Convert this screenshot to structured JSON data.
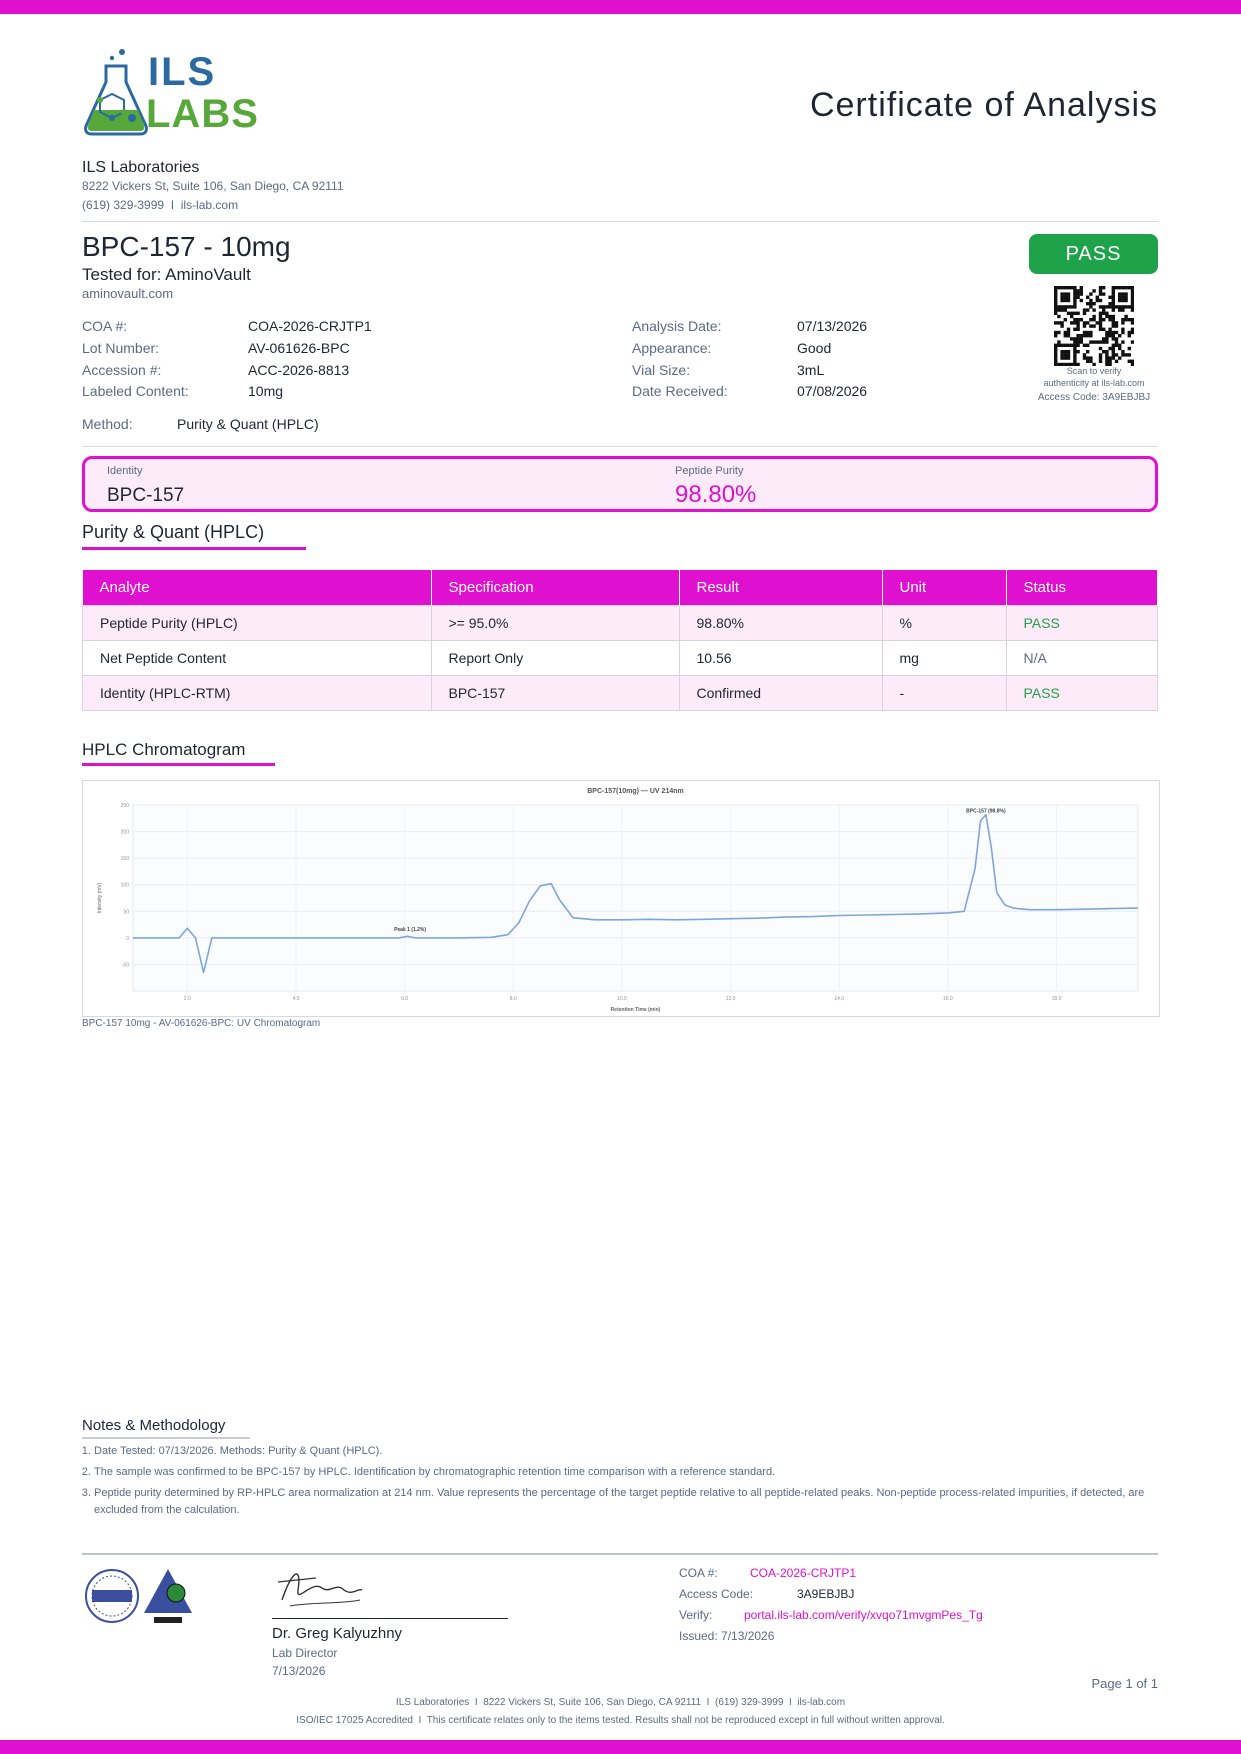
{
  "header": {
    "logo": {
      "line1": "ILS",
      "line2": "LABS",
      "icon": "flask-icon"
    },
    "title": "Certificate of Analysis",
    "lab_name": "ILS Laboratories",
    "address": "8222 Vickers St, Suite 106, San Diego, CA 92111",
    "contact": "(619) 329-3999  I  ils-lab.com"
  },
  "product": {
    "name": "BPC-157 - 10mg",
    "tested_for": "Tested for: AminoVault",
    "client_site": "aminovault.com",
    "status_badge": "PASS"
  },
  "meta_left": [
    {
      "label": "COA #:",
      "value": "COA-2026-CRJTP1"
    },
    {
      "label": "Lot Number:",
      "value": "AV-061626-BPC"
    },
    {
      "label": "Accession #:",
      "value": "ACC-2026-8813"
    },
    {
      "label": "Labeled Content:",
      "value": "10mg"
    }
  ],
  "meta_right": [
    {
      "label": "Analysis Date:",
      "value": "07/13/2026"
    },
    {
      "label": "Appearance:",
      "value": "Good"
    },
    {
      "label": "Vial Size:",
      "value": "3mL"
    },
    {
      "label": "Date Received:",
      "value": "07/08/2026"
    }
  ],
  "method": {
    "label": "Method:",
    "value": "Purity & Quant (HPLC)"
  },
  "qr": {
    "icon": "qr-code-icon",
    "caption1": "Scan to verify",
    "caption2": "authenticity at ils-lab.com",
    "access_code": "Access Code: 3A9EBJBJ"
  },
  "summary": {
    "identity_label": "Identity",
    "identity_value": "BPC-157",
    "purity_label": "Peptide Purity",
    "purity_value": "98.80%"
  },
  "results": {
    "title": "Purity & Quant (HPLC)",
    "columns": [
      "Analyte",
      "Specification",
      "Result",
      "Unit",
      "Status"
    ],
    "rows": [
      [
        "Peptide Purity (HPLC)",
        ">= 95.0%",
        "98.80%",
        "%",
        "PASS"
      ],
      [
        "Net Peptide Content",
        "Report Only",
        "10.56",
        "mg",
        "N/A"
      ],
      [
        "Identity (HPLC-RTM)",
        "BPC-157",
        "Confirmed",
        "-",
        "PASS"
      ]
    ]
  },
  "chromatogram": {
    "section_title": "HPLC Chromatogram",
    "caption": "BPC-157 10mg - AV-061626-BPC: UV Chromatogram",
    "chart_data": {
      "type": "line",
      "title": "BPC-157(10mg) — UV 214nm",
      "xlabel": "Retention Time (min)",
      "ylabel": "Intensity (mV)",
      "xlim": [
        1.0,
        19.5
      ],
      "ylim": [
        -100,
        250
      ],
      "grid": true,
      "yticks": [
        -50,
        0,
        50,
        100,
        150,
        200,
        250
      ],
      "xticks": [
        2,
        4,
        6,
        8,
        10,
        12,
        14,
        16,
        18
      ],
      "annotations": [
        {
          "text": "Peak 1 (1.2%)",
          "x": 6.1,
          "y": 2
        },
        {
          "text": "BPC-157 (98.8%)",
          "x": 16.7,
          "y": 225
        }
      ],
      "series": [
        {
          "color": "#7ea6de",
          "x": [
            1.0,
            1.7,
            1.85,
            2.0,
            2.15,
            2.3,
            2.45,
            2.6,
            3.0,
            4.0,
            5.0,
            5.9,
            6.05,
            6.2,
            6.5,
            7.0,
            7.6,
            7.9,
            8.1,
            8.3,
            8.5,
            8.7,
            8.85,
            9.1,
            9.5,
            10.0,
            10.5,
            11.0,
            11.5,
            12.0,
            12.5,
            13.0,
            13.5,
            14.0,
            14.5,
            15.0,
            15.5,
            16.0,
            16.3,
            16.5,
            16.6,
            16.7,
            16.8,
            16.9,
            17.05,
            17.2,
            17.5,
            18.0,
            18.5,
            19.0,
            19.5
          ],
          "y": [
            0,
            0,
            0,
            18,
            0,
            -65,
            0,
            0,
            0,
            0,
            0,
            0,
            3,
            0,
            0,
            0,
            1,
            6,
            28,
            70,
            98,
            102,
            72,
            38,
            34,
            34,
            35,
            34,
            35,
            36,
            37,
            39,
            40,
            42,
            43,
            44,
            45,
            47,
            50,
            130,
            220,
            232,
            170,
            85,
            62,
            56,
            53,
            53,
            54,
            55,
            56
          ]
        }
      ]
    }
  },
  "notes": {
    "title": "Notes & Methodology",
    "items": [
      "Date Tested: 07/13/2026. Methods: Purity & Quant (HPLC).",
      "The sample was confirmed to be BPC-157 by HPLC. Identification by chromatographic retention time comparison with a reference standard.",
      "Peptide purity determined by RP-HPLC area normalization at 214 nm. Value represents the percentage of the target peptide relative to all peptide-related peaks. Non-peptide process-related impurities, if detected, are excluded from the calculation."
    ]
  },
  "signature": {
    "seal1": "ilac-MRA",
    "seal2": "PJLA",
    "name": "Dr. Greg Kalyuzhny",
    "role": "Lab Director",
    "date": "7/13/2026"
  },
  "verify": {
    "coa_label": "COA #:",
    "coa_value": "COA-2026-CRJTP1",
    "access_label": "Access Code:",
    "access_value": "3A9EBJBJ",
    "verify_label": "Verify:",
    "verify_url": "portal.ils-lab.com/verify/xvqo71mvgmPes_Tg",
    "issued": "Issued: 7/13/2026"
  },
  "footer": {
    "page": "Page 1 of 1",
    "line1": "ILS Laboratories  I  8222 Vickers St, Suite 106, San Diego, CA 92111  I  (619) 329-3999  I  ils-lab.com",
    "line2": "ISO/IEC 17025 Accredited  I  This certificate relates only to the items tested. Results shall not be reproduced except in full without written approval."
  },
  "colors": {
    "accent": "#e010d0",
    "pass": "#1fa34a",
    "muted": "#5b6a85",
    "trace": "#7ea6de"
  }
}
